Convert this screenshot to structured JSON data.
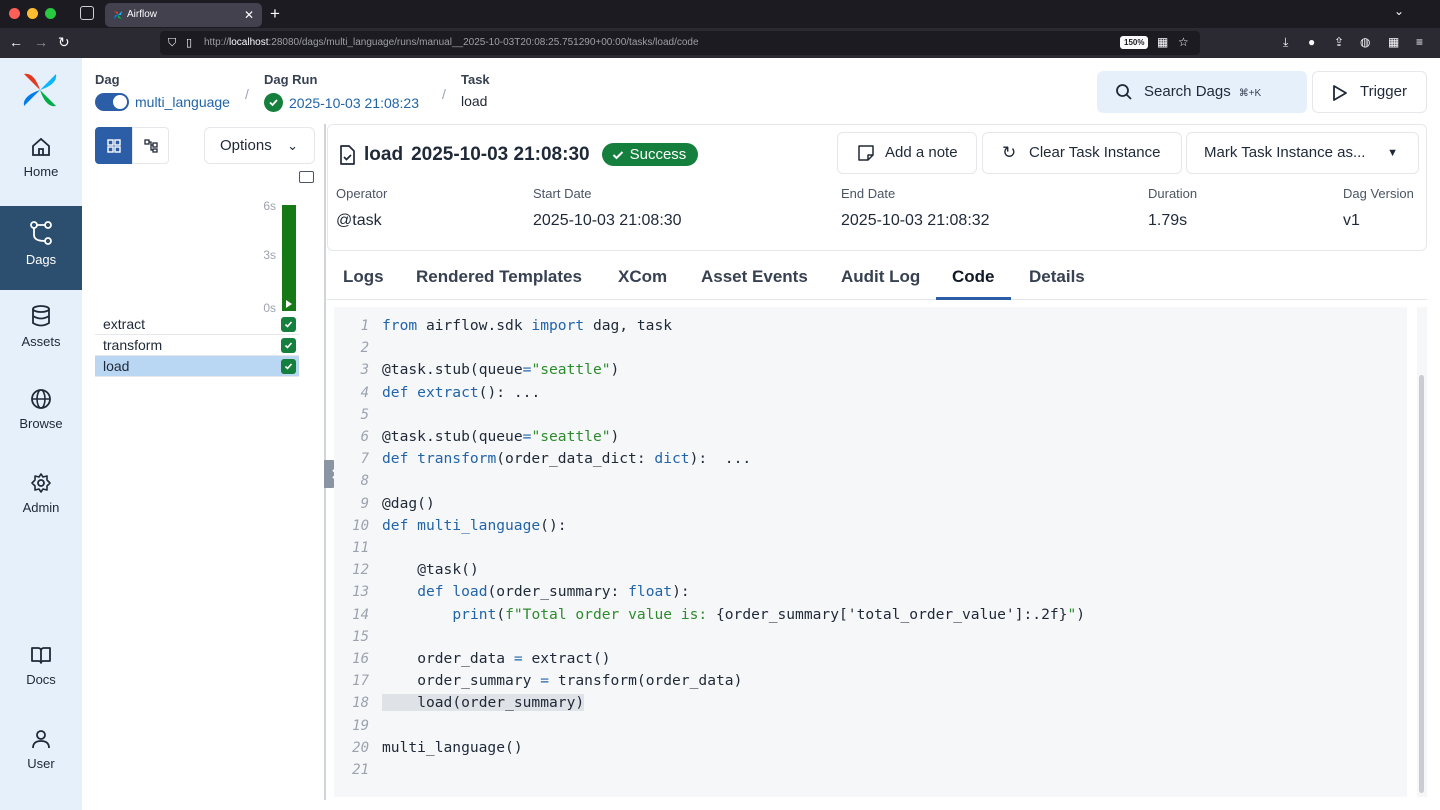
{
  "browser": {
    "tab_title": "Airflow",
    "url_prefix": "http://",
    "url_host": "localhost",
    "url_rest": ":28080/dags/multi_language/runs/manual__2025-10-03T20:08:25.751290+00:00/tasks/load/code",
    "zoom": "150%"
  },
  "nav": {
    "items": [
      {
        "label": "Home",
        "icon": "home-icon"
      },
      {
        "label": "Dags",
        "icon": "dags-icon"
      },
      {
        "label": "Assets",
        "icon": "database-icon"
      },
      {
        "label": "Browse",
        "icon": "globe-icon"
      },
      {
        "label": "Admin",
        "icon": "gear-icon"
      },
      {
        "label": "Docs",
        "icon": "book-icon"
      },
      {
        "label": "User",
        "icon": "user-icon"
      }
    ]
  },
  "breadcrumb": {
    "dag_label": "Dag",
    "dag_value": "multi_language",
    "run_label": "Dag Run",
    "run_value": "2025-10-03 21:08:23",
    "task_label": "Task",
    "task_value": "load"
  },
  "header": {
    "search_label": "Search Dags",
    "search_shortcut": "⌘+K",
    "trigger_label": "Trigger"
  },
  "grid": {
    "options_label": "Options",
    "ticks": [
      "6s",
      "3s",
      "0s"
    ],
    "tasks": [
      {
        "name": "extract",
        "selected": false
      },
      {
        "name": "transform",
        "selected": false
      },
      {
        "name": "load",
        "selected": true
      }
    ],
    "status_color": "#157a15"
  },
  "task_instance": {
    "name": "load",
    "date": "2025-10-03 21:08:30",
    "status": "Success",
    "add_note": "Add a note",
    "clear": "Clear Task Instance",
    "mark": "Mark Task Instance as...",
    "meta": {
      "operator_label": "Operator",
      "operator": "@task",
      "start_label": "Start Date",
      "start": "2025-10-03 21:08:30",
      "end_label": "End Date",
      "end": "2025-10-03 21:08:32",
      "duration_label": "Duration",
      "duration": "1.79s",
      "version_label": "Dag Version",
      "version": "v1"
    }
  },
  "tabs": [
    "Logs",
    "Rendered Templates",
    "XCom",
    "Asset Events",
    "Audit Log",
    "Code",
    "Details"
  ],
  "active_tab": "Code",
  "code": [
    "from airflow.sdk import dag, task",
    "",
    "@task.stub(queue=\"seattle\")",
    "def extract(): ...",
    "",
    "@task.stub(queue=\"seattle\")",
    "def transform(order_data_dict: dict):  ...",
    "",
    "@dag()",
    "def multi_language():",
    "",
    "    @task()",
    "    def load(order_summary: float):",
    "        print(f\"Total order value is: {order_summary['total_order_value']:.2f}\")",
    "",
    "    order_data = extract()",
    "    order_summary = transform(order_data)",
    "    load(order_summary)",
    "",
    "multi_language()",
    ""
  ],
  "highlighted_line": 18
}
